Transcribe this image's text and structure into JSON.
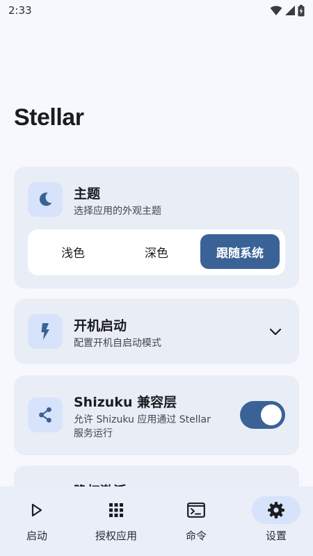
{
  "status_bar": {
    "time": "2:33"
  },
  "page": {
    "title": "Stellar"
  },
  "theme_card": {
    "title": "主题",
    "subtitle": "选择应用的外观主题",
    "icon": "moon-icon",
    "options": [
      {
        "label": "浅色",
        "selected": false
      },
      {
        "label": "深色",
        "selected": false
      },
      {
        "label": "跟随系统",
        "selected": true
      }
    ]
  },
  "boot_card": {
    "title": "开机启动",
    "subtitle": "配置开机自启动模式",
    "icon": "flash-icon",
    "expanded": false
  },
  "shizuku_card": {
    "title": "Shizuku 兼容层",
    "subtitle_line1": "允许 Shizuku 应用通过 Stellar",
    "subtitle_line2": "服务运行",
    "icon": "share-icon",
    "enabled": true
  },
  "hidden_card": {
    "title": "隐权激活"
  },
  "bottom_nav": {
    "items": [
      {
        "label": "启动",
        "icon": "play-icon",
        "active": false
      },
      {
        "label": "授权应用",
        "icon": "apps-grid-icon",
        "active": false
      },
      {
        "label": "命令",
        "icon": "terminal-icon",
        "active": false
      },
      {
        "label": "设置",
        "icon": "settings-gear-icon",
        "active": true
      }
    ]
  },
  "colors": {
    "accent": "#3a6296",
    "card_bg": "#e8edf6",
    "icon_bg": "#d7e3fb",
    "page_bg": "#f7f8fd"
  }
}
